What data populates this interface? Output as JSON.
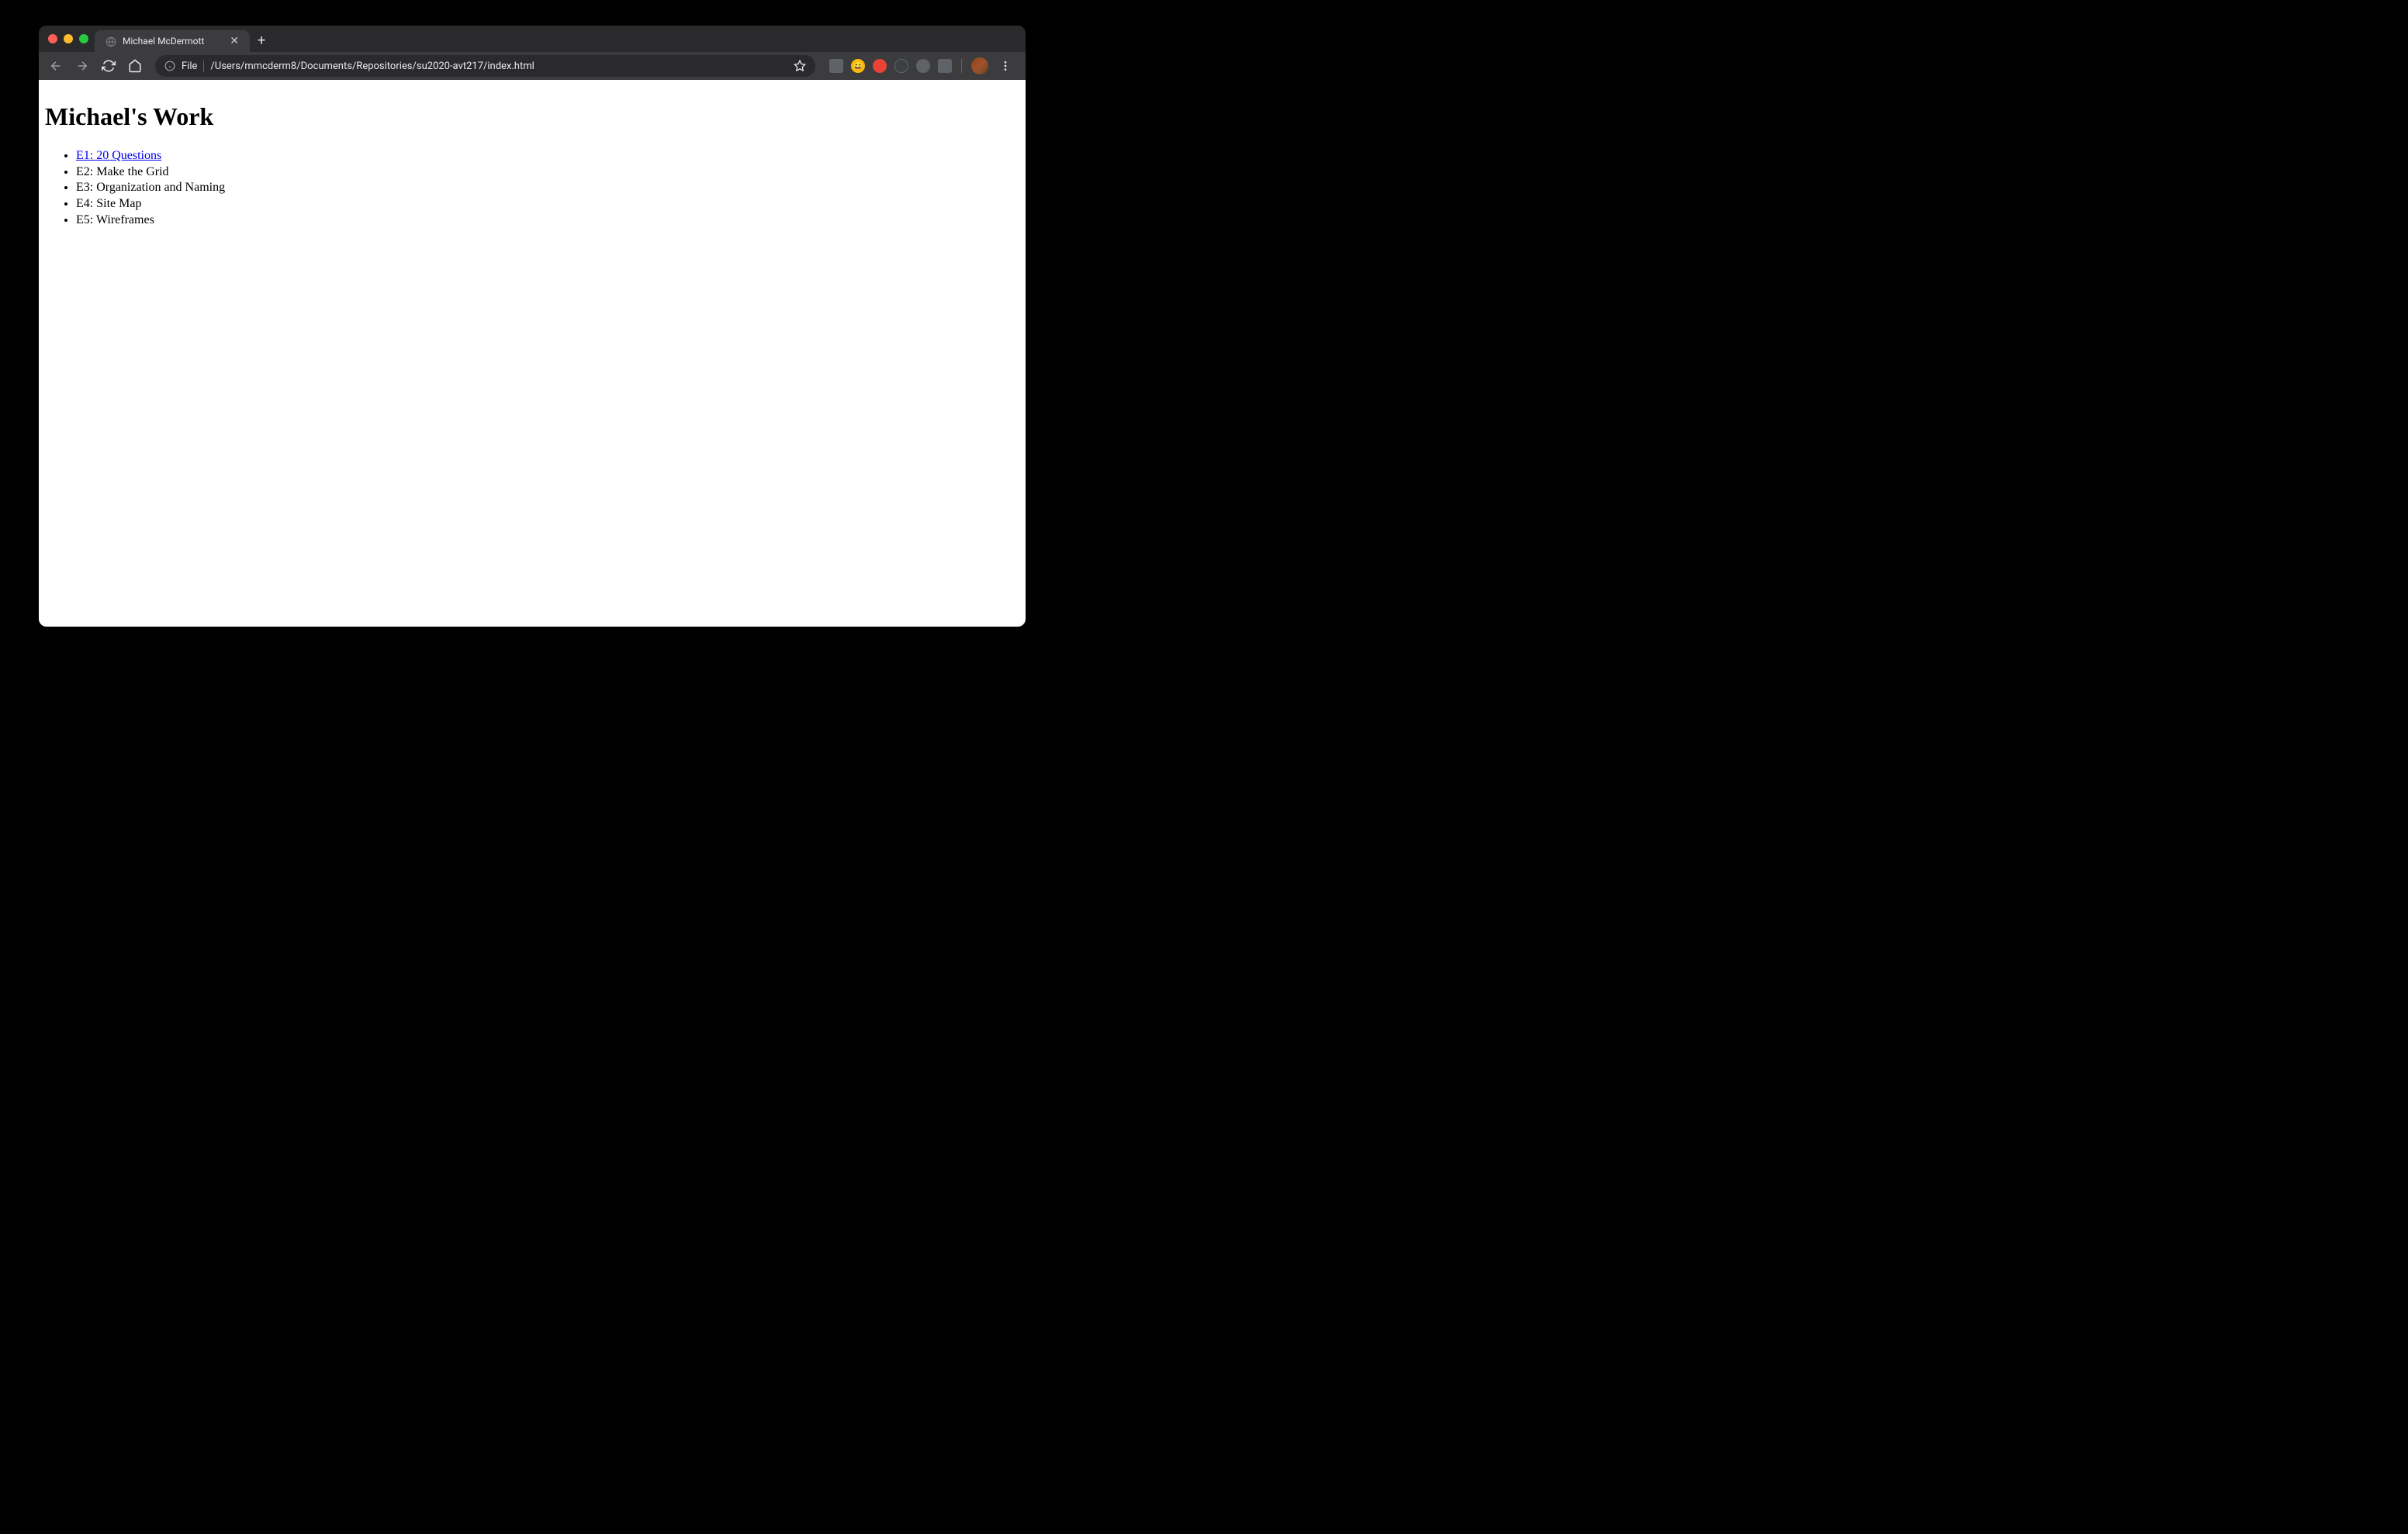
{
  "browser": {
    "tab_title": "Michael McDermott",
    "address": {
      "scheme": "File",
      "path": "/Users/mmcderm8/Documents/Repositories/su2020-avt217/index.html"
    }
  },
  "page": {
    "heading": "Michael's Work",
    "items": [
      {
        "label": "E1: 20 Questions",
        "link": true
      },
      {
        "label": "E2: Make the Grid",
        "link": false
      },
      {
        "label": "E3: Organization and Naming",
        "link": false
      },
      {
        "label": "E4: Site Map",
        "link": false
      },
      {
        "label": "E5: Wireframes",
        "link": false
      }
    ]
  }
}
